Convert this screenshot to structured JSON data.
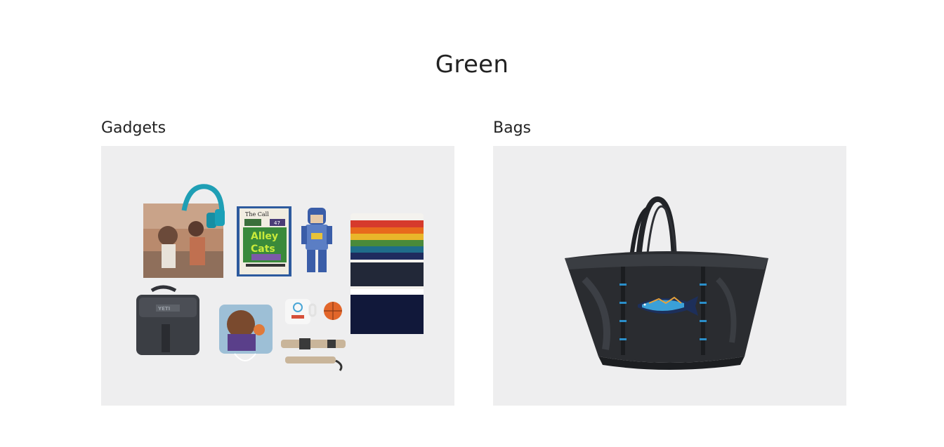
{
  "page": {
    "title": "Green"
  },
  "categories": [
    {
      "label": "Gadgets",
      "image_icon": "gadgets-flatlay-photo"
    },
    {
      "label": "Bags",
      "image_icon": "black-tote-bag-photo"
    }
  ],
  "gadgets_photo": {
    "magazine_lines": [
      "The Call",
      "47",
      "Alley",
      "Cats"
    ],
    "cooler_brand": "YETI"
  }
}
